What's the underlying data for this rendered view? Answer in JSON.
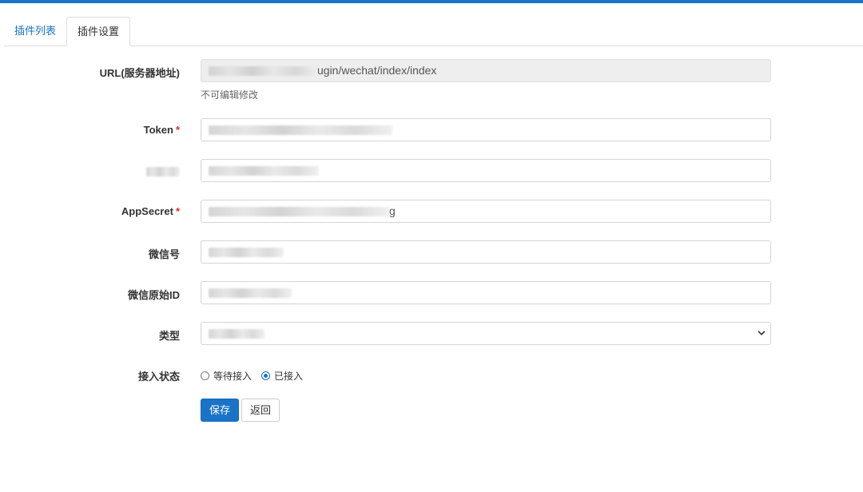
{
  "tabs": [
    {
      "label": "插件列表",
      "active": false
    },
    {
      "label": "插件设置",
      "active": true
    }
  ],
  "form": {
    "url": {
      "label": "URL(服务器地址)",
      "value_suffix": "ugin/wechat/index/index",
      "help": "不可编辑修改"
    },
    "token": {
      "label": "Token",
      "required_mark": "*"
    },
    "appid": {
      "label": ""
    },
    "appsecret": {
      "label": "AppSecret",
      "required_mark": "*",
      "value_suffix": "g"
    },
    "wechat_no": {
      "label": "微信号"
    },
    "original_id": {
      "label": "微信原始ID"
    },
    "type": {
      "label": "类型"
    },
    "status": {
      "label": "接入状态",
      "options": [
        {
          "label": "等待接入",
          "checked": false
        },
        {
          "label": "已接入",
          "checked": true
        }
      ]
    }
  },
  "buttons": {
    "save": "保存",
    "back": "返回"
  },
  "colors": {
    "accent": "#1a73c7",
    "required": "#e02b2b"
  }
}
